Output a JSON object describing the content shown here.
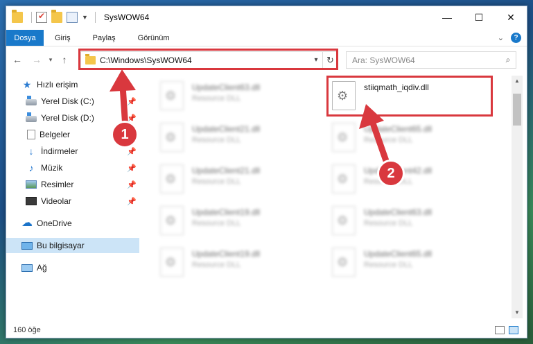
{
  "window": {
    "title": "SysWOW64",
    "controls": {
      "minimize": "—",
      "maximize": "☐",
      "close": "✕"
    }
  },
  "ribbon": {
    "tabs": [
      {
        "label": "Dosya"
      },
      {
        "label": "Giriş"
      },
      {
        "label": "Paylaş"
      },
      {
        "label": "Görünüm"
      }
    ]
  },
  "address": {
    "path": "C:\\Windows\\SysWOW64"
  },
  "search": {
    "placeholder": "Ara: SysWOW64"
  },
  "nav": {
    "quick_access": "Hızlı erişim",
    "items": [
      {
        "label": "Yerel Disk (C:)",
        "icon": "disk-icon"
      },
      {
        "label": "Yerel Disk (D:)",
        "icon": "disk-icon"
      },
      {
        "label": "Belgeler",
        "icon": "documents-icon"
      },
      {
        "label": "İndirmeler",
        "icon": "downloads-icon"
      },
      {
        "label": "Müzik",
        "icon": "music-icon"
      },
      {
        "label": "Resimler",
        "icon": "pictures-icon"
      },
      {
        "label": "Videolar",
        "icon": "videos-icon"
      }
    ],
    "onedrive": "OneDrive",
    "this_pc": "Bu bilgisayar",
    "network": "Ağ"
  },
  "files": {
    "left_column": [
      {
        "name": "UpdateClient63.dll",
        "desc": "Resource DLL"
      },
      {
        "name": "UpdateClient21.dll",
        "desc": "Resource DLL"
      },
      {
        "name": "UpdateClient21.dll",
        "desc": "Resource DLL"
      },
      {
        "name": "UpdateClient19.dll",
        "desc": "Resource DLL"
      },
      {
        "name": "UpdateClient19.dll",
        "desc": "Resource DLL"
      }
    ],
    "right_column": [
      {
        "name": "stiiqmath_iqdiv.dll",
        "desc": ""
      },
      {
        "name": "UpdateClient65.dll",
        "desc": "Resource DLL"
      },
      {
        "name": "UpdateClient42.dll",
        "desc": "Resource DLL"
      },
      {
        "name": "UpdateClient63.dll",
        "desc": "Resource DLL"
      },
      {
        "name": "UpdateClient65.dll",
        "desc": "Resource DLL"
      }
    ]
  },
  "status": {
    "item_count": "160 öğe"
  },
  "annotations": {
    "badge_1": "1",
    "badge_2": "2",
    "highlight_color": "#d9383e"
  }
}
